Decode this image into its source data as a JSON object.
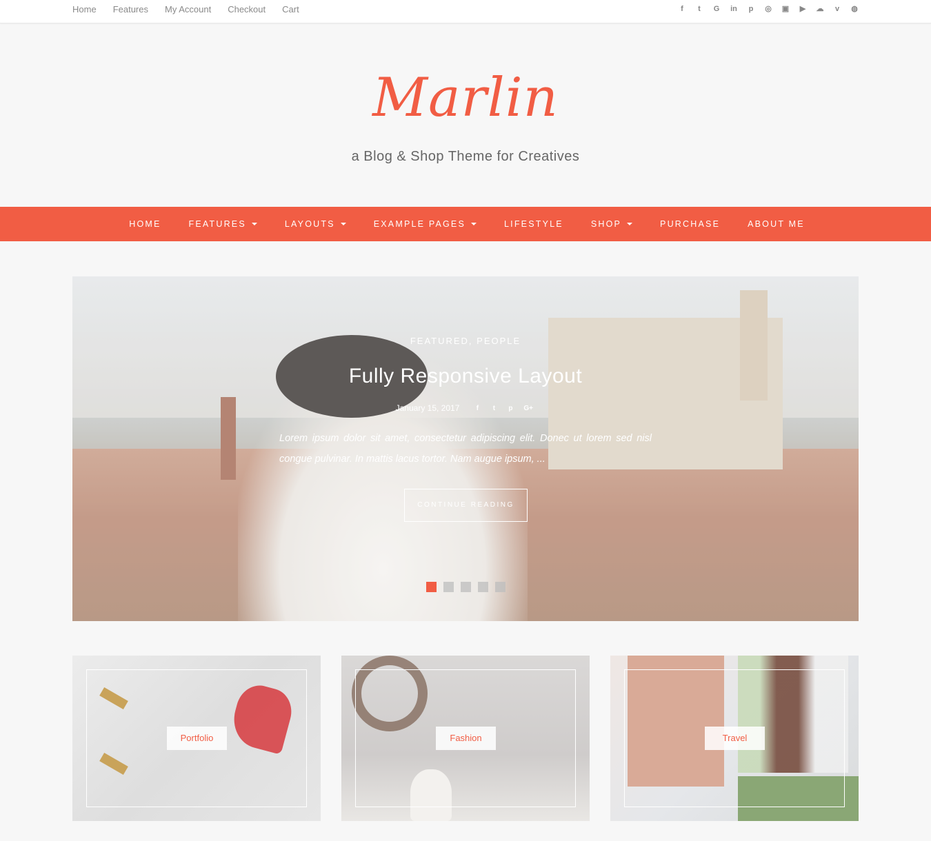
{
  "topbar": {
    "links": [
      "Home",
      "Features",
      "My Account",
      "Checkout",
      "Cart"
    ],
    "social_icons": [
      "facebook-icon",
      "twitter-icon",
      "google-plus-icon",
      "linkedin-icon",
      "pinterest-icon",
      "instagram-icon",
      "flickr-icon",
      "youtube-icon",
      "soundcloud-icon",
      "vimeo-icon",
      "dribbble-icon"
    ]
  },
  "header": {
    "logo": "Marlin",
    "tagline": "a Blog & Shop Theme for Creatives"
  },
  "nav": {
    "items": [
      "HOME",
      "FEATURES",
      "LAYOUTS",
      "EXAMPLE PAGES",
      "LIFESTYLE",
      "SHOP",
      "PURCHASE",
      "ABOUT ME"
    ]
  },
  "hero": {
    "categories": "FEATURED, PEOPLE",
    "title": "Fully Responsive Layout",
    "date": "January 15, 2017",
    "excerpt": "Lorem ipsum dolor sit amet, consectetur adipiscing elit. Donec ut lorem sed nisl congue pulvinar. In mattis lacus tortor. Nam augue ipsum, ...",
    "button": "CONTINUE READING"
  },
  "cards": [
    {
      "label": "Portfolio"
    },
    {
      "label": "Fashion"
    },
    {
      "label": "Travel"
    }
  ],
  "colors": {
    "accent": "#f15d44",
    "background": "#f7f7f7"
  }
}
